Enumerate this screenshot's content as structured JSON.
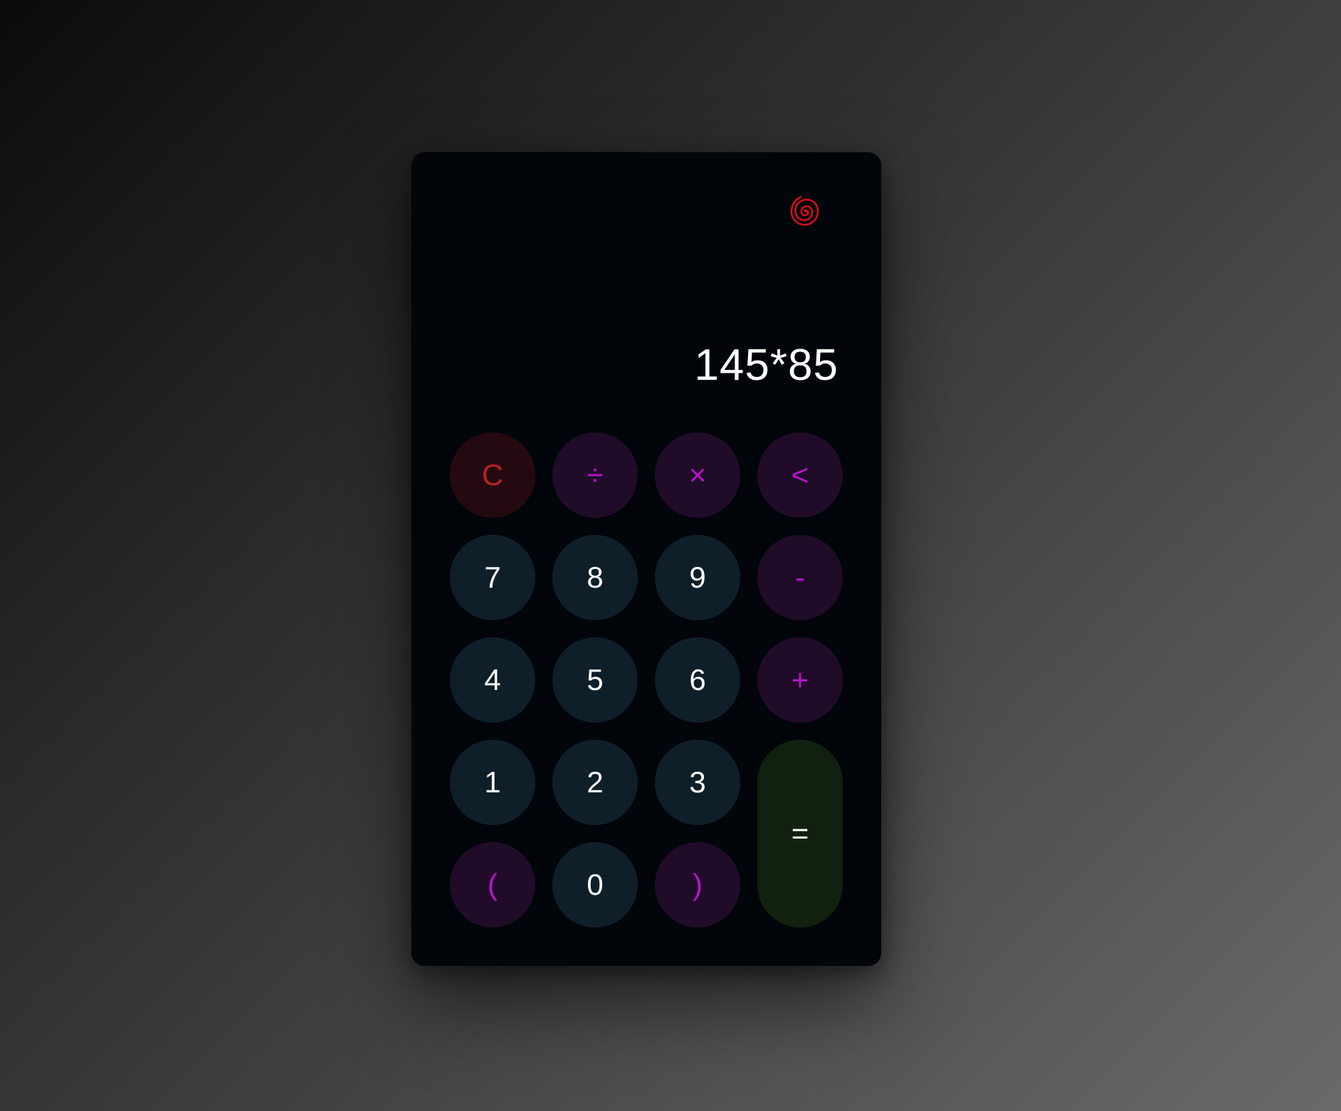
{
  "display": {
    "expression": "145*85"
  },
  "logo": {
    "icon": "spiral-logo-icon",
    "color": "#d20d1e"
  },
  "keys": {
    "clear": "C",
    "divide": "÷",
    "multiply": "×",
    "backspace": "<",
    "seven": "7",
    "eight": "8",
    "nine": "9",
    "minus": "-",
    "four": "4",
    "five": "5",
    "six": "6",
    "plus": "+",
    "one": "1",
    "two": "2",
    "three": "3",
    "equals": "=",
    "open_paren": "(",
    "zero": "0",
    "close_paren": ")"
  },
  "colors": {
    "number_key_bg": "#0e1f29",
    "operator_key_bg": "#200c28",
    "operator_text": "#b515c7",
    "clear_key_bg": "#240a10",
    "clear_text": "#b1232b",
    "equals_key_bg": "#12200f"
  }
}
